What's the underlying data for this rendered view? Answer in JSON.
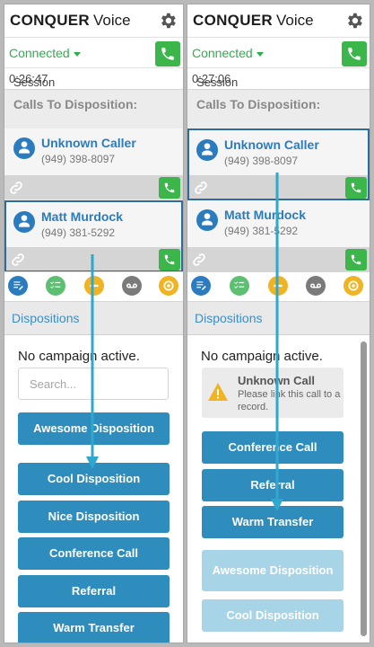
{
  "left": {
    "brand": {
      "bold": "CONQUER",
      "light": "Voice"
    },
    "status": "Connected",
    "session_label": "Session Time:",
    "session_time": "0:26:47",
    "calls_title": "Calls To Disposition:",
    "calls": [
      {
        "name": "Unknown Caller",
        "phone": "(949) 398-8097"
      },
      {
        "name": "Matt Murdock",
        "phone": "(949) 381-5292"
      }
    ],
    "dispositions_tab": "Dispositions",
    "no_campaign": "No campaign active.",
    "search_placeholder": "Search...",
    "buttons": [
      "Awesome Disposition",
      "Cool Disposition",
      "Nice Disposition",
      "Conference Call",
      "Referral",
      "Warm Transfer"
    ]
  },
  "right": {
    "brand": {
      "bold": "CONQUER",
      "light": "Voice"
    },
    "status": "Connected",
    "session_label": "Session Time:",
    "session_time": "0:27:06",
    "calls_title": "Calls To Disposition:",
    "calls": [
      {
        "name": "Unknown Caller",
        "phone": "(949) 398-8097"
      },
      {
        "name": "Matt Murdock",
        "phone": "(949) 381-5292"
      }
    ],
    "dispositions_tab": "Dispositions",
    "no_campaign": "No campaign active.",
    "warning_title": "Unknown Call",
    "warning_text": "Please link this call to a record.",
    "buttons": [
      "Conference Call",
      "Referral",
      "Warm Transfer"
    ],
    "faded_buttons": [
      "Awesome Disposition",
      "Cool Disposition"
    ]
  },
  "colors": {
    "accent": "#2f8dbd",
    "connected": "#2fae4e",
    "phone_button": "#3cb54a",
    "arrow": "#2fa8cf",
    "selected_border": "#2e6ca0"
  },
  "icons": [
    "gear-icon",
    "phone-icon",
    "user-icon",
    "link-icon",
    "notes-icon",
    "checklist-icon",
    "transfer-icon",
    "voicemail-icon",
    "help-icon",
    "warning-icon"
  ]
}
